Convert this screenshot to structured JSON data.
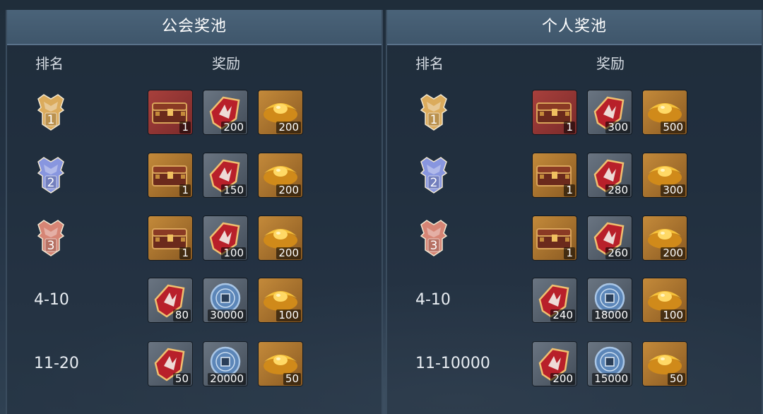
{
  "panels": [
    {
      "title": "公会奖池",
      "rank_header": "排名",
      "reward_header": "奖励",
      "rows": [
        {
          "rank": "1",
          "rank_type": "badge",
          "badge_color": "#e6b25e",
          "items": [
            {
              "icon": "chest",
              "qty": "1",
              "bg": "red"
            },
            {
              "icon": "scroll",
              "qty": "200",
              "bg": "gray"
            },
            {
              "icon": "gold",
              "qty": "200",
              "bg": "gold"
            }
          ]
        },
        {
          "rank": "2",
          "rank_type": "badge",
          "badge_color": "#8e9ce8",
          "items": [
            {
              "icon": "chest",
              "qty": "1",
              "bg": "gold"
            },
            {
              "icon": "scroll",
              "qty": "150",
              "bg": "gray"
            },
            {
              "icon": "gold",
              "qty": "200",
              "bg": "gold"
            }
          ]
        },
        {
          "rank": "3",
          "rank_type": "badge",
          "badge_color": "#e08a78",
          "items": [
            {
              "icon": "chest",
              "qty": "1",
              "bg": "gold"
            },
            {
              "icon": "scroll",
              "qty": "100",
              "bg": "gray"
            },
            {
              "icon": "gold",
              "qty": "200",
              "bg": "gold"
            }
          ]
        },
        {
          "rank": "4-10",
          "rank_type": "text",
          "items": [
            {
              "icon": "scroll",
              "qty": "80",
              "bg": "gray"
            },
            {
              "icon": "coin",
              "qty": "30000",
              "bg": "gray"
            },
            {
              "icon": "gold",
              "qty": "100",
              "bg": "gold"
            }
          ]
        },
        {
          "rank": "11-20",
          "rank_type": "text",
          "items": [
            {
              "icon": "scroll",
              "qty": "50",
              "bg": "gray"
            },
            {
              "icon": "coin",
              "qty": "20000",
              "bg": "gray"
            },
            {
              "icon": "gold",
              "qty": "50",
              "bg": "gold"
            }
          ]
        }
      ]
    },
    {
      "title": "个人奖池",
      "rank_header": "排名",
      "reward_header": "奖励",
      "rows": [
        {
          "rank": "1",
          "rank_type": "badge",
          "badge_color": "#e6b25e",
          "items": [
            {
              "icon": "chest",
              "qty": "1",
              "bg": "red"
            },
            {
              "icon": "scroll",
              "qty": "300",
              "bg": "gray"
            },
            {
              "icon": "gold",
              "qty": "500",
              "bg": "gold"
            }
          ]
        },
        {
          "rank": "2",
          "rank_type": "badge",
          "badge_color": "#8e9ce8",
          "items": [
            {
              "icon": "chest",
              "qty": "1",
              "bg": "gold"
            },
            {
              "icon": "scroll",
              "qty": "280",
              "bg": "gray"
            },
            {
              "icon": "gold",
              "qty": "300",
              "bg": "gold"
            }
          ]
        },
        {
          "rank": "3",
          "rank_type": "badge",
          "badge_color": "#e08a78",
          "items": [
            {
              "icon": "chest",
              "qty": "1",
              "bg": "gold"
            },
            {
              "icon": "scroll",
              "qty": "260",
              "bg": "gray"
            },
            {
              "icon": "gold",
              "qty": "200",
              "bg": "gold"
            }
          ]
        },
        {
          "rank": "4-10",
          "rank_type": "text",
          "items": [
            {
              "icon": "scroll",
              "qty": "240",
              "bg": "gray"
            },
            {
              "icon": "coin",
              "qty": "18000",
              "bg": "gray"
            },
            {
              "icon": "gold",
              "qty": "100",
              "bg": "gold"
            }
          ]
        },
        {
          "rank": "11-10000",
          "rank_type": "text",
          "items": [
            {
              "icon": "scroll",
              "qty": "200",
              "bg": "gray"
            },
            {
              "icon": "coin",
              "qty": "15000",
              "bg": "gray"
            },
            {
              "icon": "gold",
              "qty": "50",
              "bg": "gold"
            }
          ]
        }
      ]
    }
  ]
}
